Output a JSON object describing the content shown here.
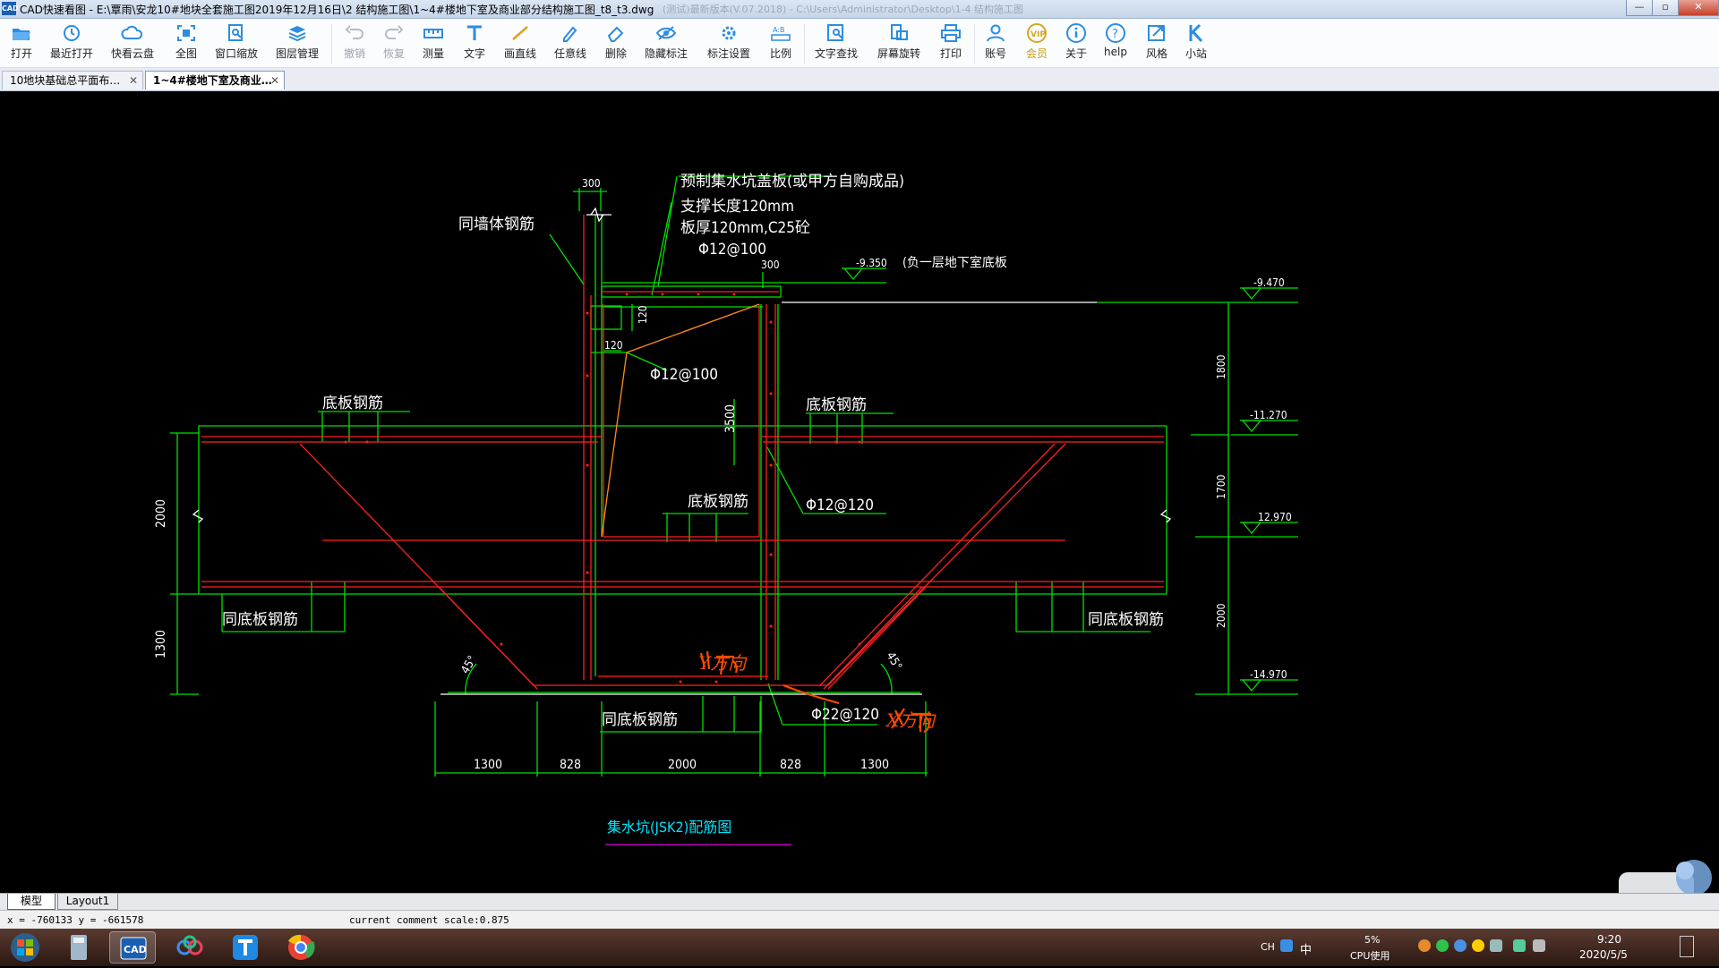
{
  "window": {
    "app_icon": "CAD",
    "title": "CAD快速看图 - E:\\覃雨\\安龙10#地块全套施工图2019年12月16日\\2    结构施工图\\1~4#楼地下室及商业部分结构施工图_t8_t3.dwg",
    "title_overlay": "(测试)最新版本(V.07.2018) - C:\\Users\\Administrator\\Desktop\\1-4 结构施工图",
    "minimize": "—",
    "maximize": "▫",
    "close": "✕"
  },
  "toolbar": {
    "items": [
      {
        "label": "打开",
        "icon": "open-folder-icon"
      },
      {
        "label": "最近打开",
        "icon": "recent-clock-icon"
      },
      {
        "label": "快看云盘",
        "icon": "cloud-icon"
      },
      {
        "label": "全图",
        "icon": "fit-all-icon"
      },
      {
        "label": "窗口缩放",
        "icon": "zoom-window-icon"
      },
      {
        "label": "图层管理",
        "icon": "layers-icon"
      },
      {
        "label": "撤销",
        "icon": "undo-icon"
      },
      {
        "label": "恢复",
        "icon": "redo-icon"
      },
      {
        "label": "测量",
        "icon": "measure-icon"
      },
      {
        "label": "文字",
        "icon": "text-icon"
      },
      {
        "label": "画直线",
        "icon": "line-icon"
      },
      {
        "label": "任意线",
        "icon": "freehand-icon"
      },
      {
        "label": "删除",
        "icon": "eraser-icon"
      },
      {
        "label": "隐藏标注",
        "icon": "hide-eye-icon"
      },
      {
        "label": "标注设置",
        "icon": "annotation-settings-icon"
      },
      {
        "label": "比例",
        "icon": "scale-icon"
      },
      {
        "label": "文字查找",
        "icon": "text-search-icon"
      },
      {
        "label": "屏幕旋转",
        "icon": "rotate-screen-icon"
      },
      {
        "label": "打印",
        "icon": "printer-icon"
      },
      {
        "label": "账号",
        "icon": "user-icon"
      },
      {
        "label": "会员",
        "icon": "vip-icon"
      },
      {
        "label": "关于",
        "icon": "info-icon"
      },
      {
        "label": "help",
        "icon": "help-icon"
      },
      {
        "label": "风格",
        "icon": "style-icon"
      },
      {
        "label": "小站",
        "icon": "k-station-icon"
      }
    ]
  },
  "tabs": [
    {
      "label": "10地块基础总平面布…",
      "close": "✕"
    },
    {
      "label": "1~4#楼地下室及商业…",
      "close": "✕"
    }
  ],
  "drawing": {
    "texts": {
      "cover_note1": "预制集水坑盖板(或甲方自购成品)",
      "cover_note2": "支撑长度120mm",
      "cover_note3": "板厚120mm,C25砼",
      "cover_note4": "Φ12@100",
      "wall_rebar": "同墙体钢筋",
      "dim_300_top": "300",
      "dim_300_right": "300",
      "elev_9350": "-9.350",
      "basement_note": "(负一层地下室底板",
      "elev_9470": "-9.470",
      "elev_11270": "-11.270",
      "elev_12970": "12.970",
      "elev_14970": "-14.970",
      "dim_120_v": "120",
      "dim_120_h": "120",
      "rebar_inner": "Φ12@100",
      "dim_3500": "3500",
      "slab_left": "底板钢筋",
      "slab_right": "底板钢筋",
      "slab_pit": "底板钢筋",
      "rebar_wall_side": "Φ12@120",
      "dim_2000_left": "2000",
      "dim_1300_left": "1300",
      "same_slab_left": "同底板钢筋",
      "same_slab_right": "同底板钢筋",
      "same_slab_bottom": "同底板钢筋",
      "angle_left": "45°",
      "angle_right": "45°",
      "rebar_bottom": "Φ22@120",
      "handwrite1": "Y方向",
      "handwrite2": "X方向",
      "dim_1800": "1800",
      "dim_1700": "1700",
      "dim_2000_right": "2000",
      "dim_bot_1": "1300",
      "dim_bot_2": "828",
      "dim_bot_3": "2000",
      "dim_bot_4": "828",
      "dim_bot_5": "1300",
      "caption": "集水坑(JSK2)配筋图"
    }
  },
  "layout_tabs": [
    "模型",
    "Layout1"
  ],
  "status": {
    "coords": "x = -760133  y = -661578",
    "comment_scale": "current comment scale:0.875"
  },
  "tray": {
    "lang": "CH",
    "ime": "中",
    "cpu_value": "5%",
    "cpu_label": "CPU使用",
    "time": "9:20",
    "date": "2020/5/5"
  },
  "colors": {
    "green": "#00e000",
    "red": "#ff2020",
    "darkred": "#c00000",
    "white": "#ffffff",
    "orange": "#ff8c1a",
    "cyan": "#00e5ff",
    "magenta": "#e000e0",
    "handwriting": "#ff4a00"
  }
}
